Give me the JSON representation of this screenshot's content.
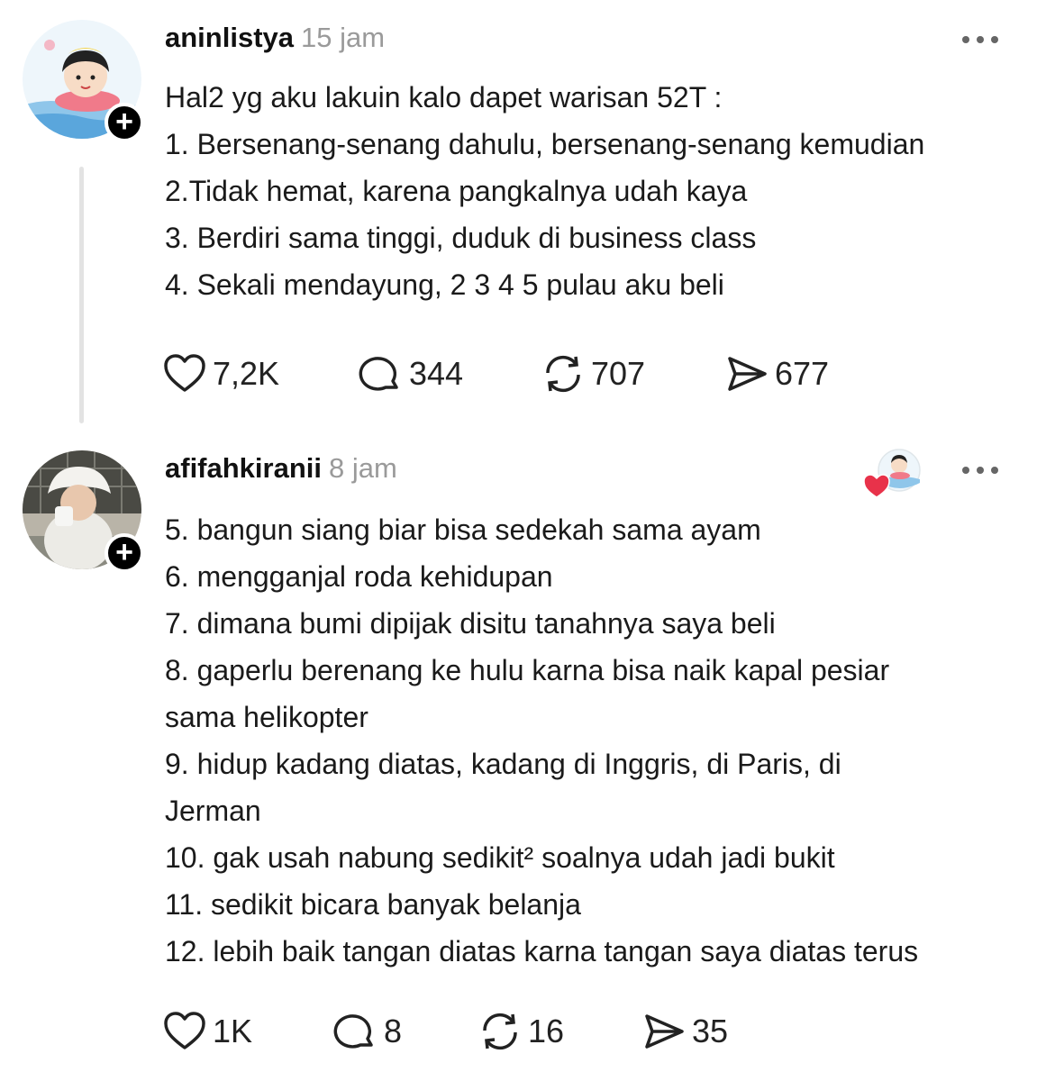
{
  "posts": [
    {
      "username": "aninlistya",
      "time": "15 jam",
      "lines": [
        "Hal2 yg aku lakuin kalo dapet warisan 52T :",
        "1. Bersenang-senang dahulu, bersenang-senang kemudian",
        "2.Tidak hemat, karena pangkalnya udah kaya",
        "3. Berdiri sama tinggi, duduk di business class",
        "4. Sekali mendayung, 2 3 4 5 pulau aku beli"
      ],
      "likes": "7,2K",
      "replies": "344",
      "reposts": "707",
      "shares": "677"
    },
    {
      "username": "afifahkiranii",
      "time": "8 jam",
      "lines": [
        "5. bangun siang biar bisa sedekah sama ayam",
        "6. mengganjal roda kehidupan",
        "7. dimana bumi dipijak disitu tanahnya saya beli",
        "8. gaperlu berenang ke hulu karna bisa naik kapal pesiar",
        "sama helikopter",
        "9. hidup kadang diatas, kadang di Inggris, di Paris, di",
        "Jerman",
        "10. gak usah nabung sedikit² soalnya udah jadi bukit",
        "11. sedikit bicara banyak belanja",
        "12. lebih baik tangan diatas karna tangan saya diatas terus"
      ],
      "likes": "1K",
      "replies": "8",
      "reposts": "16",
      "shares": "35"
    }
  ],
  "icons": {
    "like": "heart-icon",
    "reply": "comment-icon",
    "repost": "repost-icon",
    "share": "send-icon",
    "more": "more-options-icon",
    "follow": "plus-icon"
  },
  "colors": {
    "text": "#1a1a1a",
    "muted": "#9a9a9a",
    "line": "#e3e3e3",
    "heart": "#e8324a"
  }
}
